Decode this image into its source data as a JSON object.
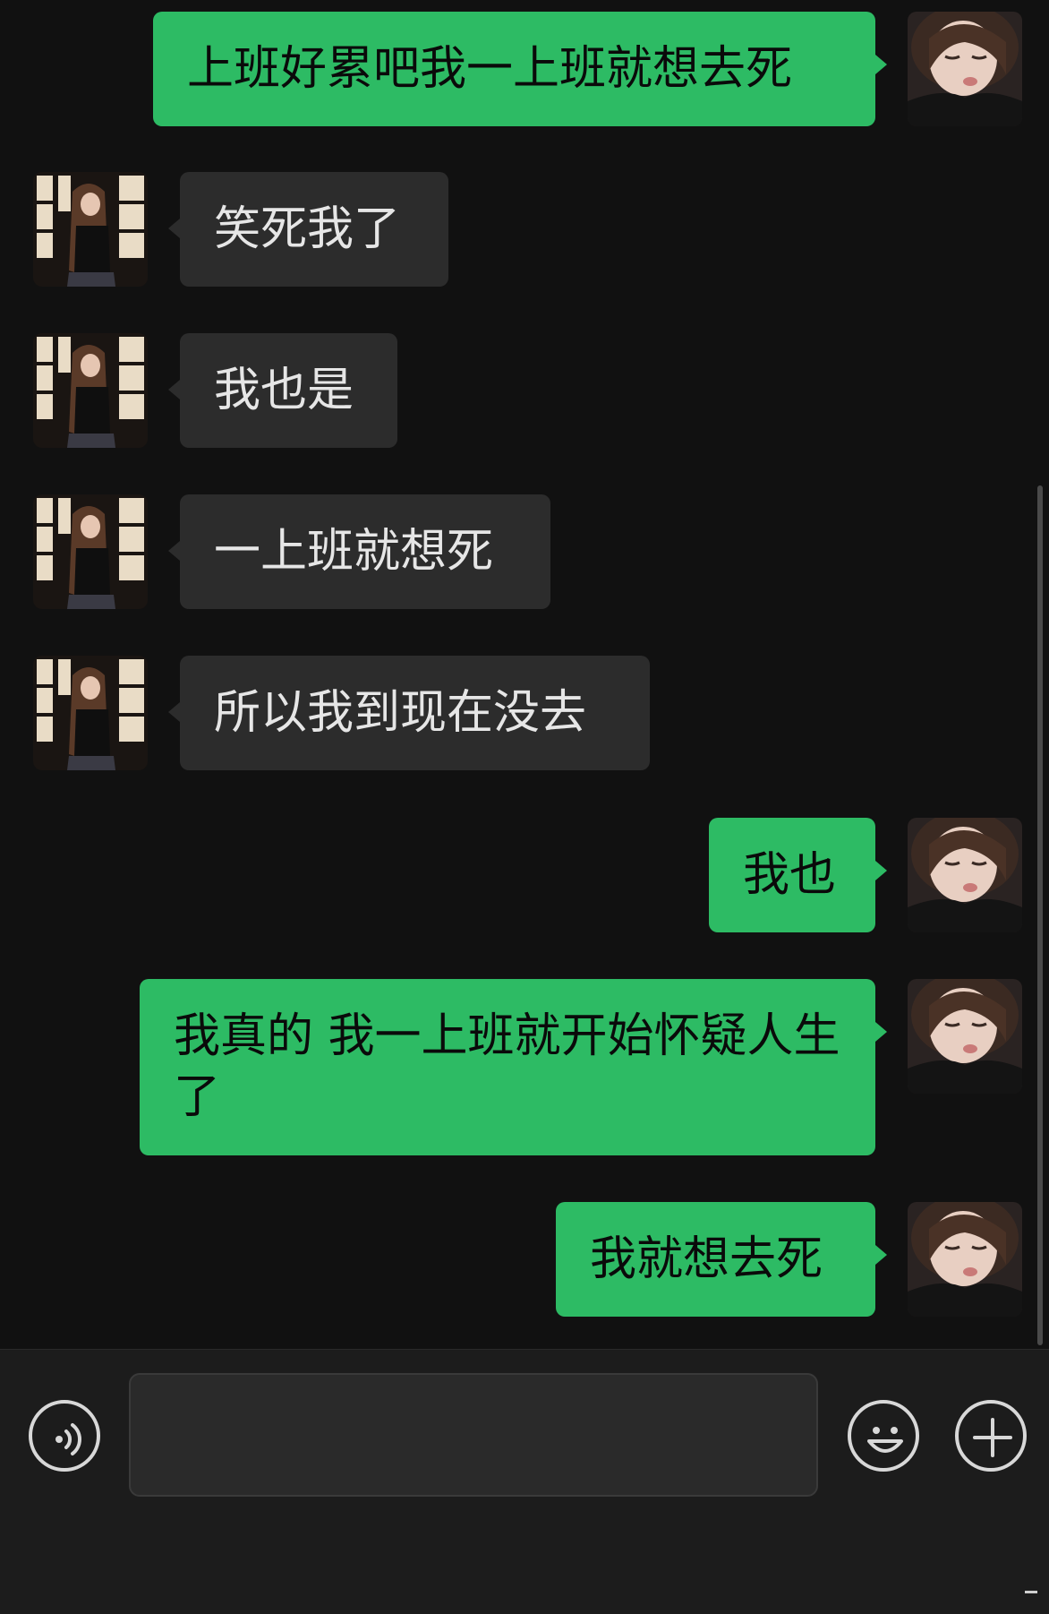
{
  "messages": [
    {
      "sender": "me",
      "avatar": "me-avatar",
      "text": "上班好累吧我一上班就想去死"
    },
    {
      "sender": "them",
      "avatar": "contact-avatar",
      "text": "笑死我了"
    },
    {
      "sender": "them",
      "avatar": "contact-avatar",
      "text": "我也是"
    },
    {
      "sender": "them",
      "avatar": "contact-avatar",
      "text": "一上班就想死"
    },
    {
      "sender": "them",
      "avatar": "contact-avatar",
      "text": "所以我到现在没去"
    },
    {
      "sender": "me",
      "avatar": "me-avatar",
      "text": "我也"
    },
    {
      "sender": "me",
      "avatar": "me-avatar",
      "text": "我真的 我一上班就开始怀疑人生了"
    },
    {
      "sender": "me",
      "avatar": "me-avatar",
      "text": "我就想去死"
    }
  ],
  "input_bar": {
    "text_value": "",
    "voice_icon": "voice-icon",
    "emoji_icon": "emoji-icon",
    "plus_icon": "plus-icon"
  },
  "colors": {
    "background": "#111111",
    "my_bubble": "#2dbb64",
    "their_bubble": "#2c2c2c",
    "input_bar": "#1c1c1c"
  }
}
